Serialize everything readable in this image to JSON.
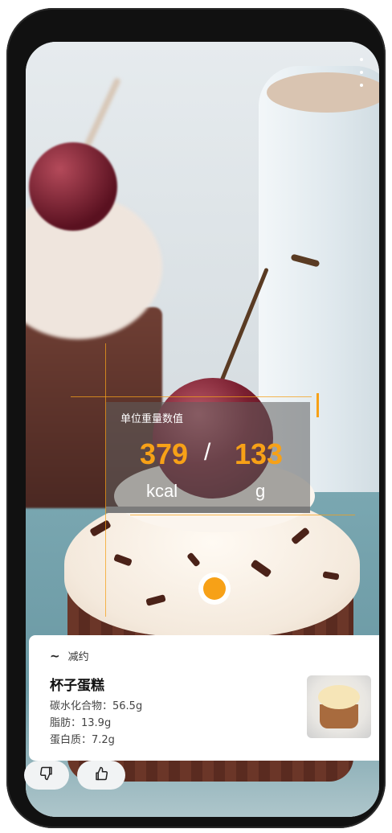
{
  "overlay": {
    "panel_title": "单位重量数值",
    "kcal_value": "379",
    "separator": "/",
    "gram_value": "133",
    "kcal_unit": "kcal",
    "gram_unit": "g"
  },
  "result_card": {
    "tag_icon": "~",
    "tag_label": "减约",
    "food_name": "杯子蛋糕",
    "nutrients": [
      "碳水化合物：56.5g",
      "脂肪：13.9g",
      "蛋白质：7.2g"
    ]
  },
  "icons": {
    "more": "more-vertical-icon",
    "dislike": "thumb-down-icon",
    "like": "thumb-up-icon"
  },
  "colors": {
    "accent": "#f7a117",
    "panel": "#5f5f5f"
  }
}
